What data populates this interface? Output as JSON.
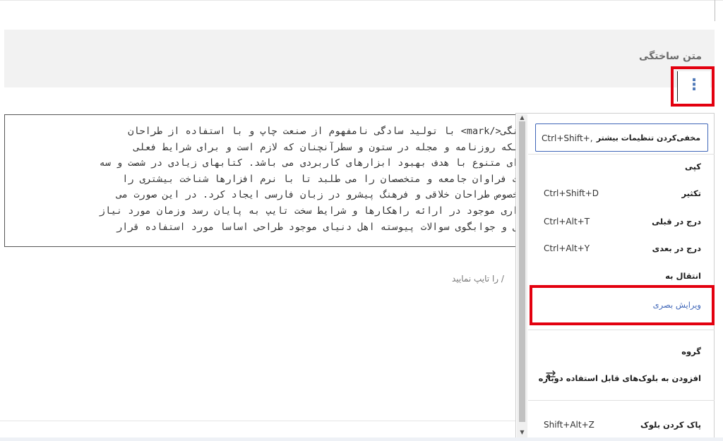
{
  "block": {
    "title": "متن ساختگی",
    "options_icon": "⋮"
  },
  "editor": {
    "lines": [
      "نگی</mark> با تولید سادگی نامفهوم از صنعت چاپ و با استفاده از طراحان",
      "لکه روزنامه و مجله در ستون و سطرآنچنان که لازم است و برای شرایط فعلی",
      "ای متنوع با هدف بهبود ابزارهای کاربردی می باشد. کتابهای زیادی در شصت و سه",
      "ت فراوان جامعه و متخصصان را می طلبد تا با نرم افزارها شناخت بیشتری را",
      "خصوص طراحان خلاقی و فرهنگ پیشرو در زبان فارسی ایجاد کرد. در این صورت می",
      "اری موجود در ارائه راهکارها و شرایط سخت تایپ به پایان رسد وزمان مورد نیاز",
      "ی و جوابگوی سوالات پیوسته اهل دنیای موجود طراحی اساسا مورد استفاده قرار"
    ],
    "hint": "/ را تایپ نمایید"
  },
  "menu": {
    "toggle_settings": {
      "label": "مخفی‌کردن تنظیمات بیشتر",
      "shortcut": "Ctrl+Shift+,"
    },
    "copy": {
      "label": "کپی"
    },
    "duplicate": {
      "label": "تکثیر",
      "shortcut": "Ctrl+Shift+D"
    },
    "insert_before": {
      "label": "درج در قبلی",
      "shortcut": "Ctrl+Alt+T"
    },
    "insert_after": {
      "label": "درج در بعدی",
      "shortcut": "Ctrl+Alt+Y"
    },
    "move_to": {
      "label": "انتقال به"
    },
    "edit_visually": {
      "label": "ویرایش بصری"
    },
    "group": {
      "label": "گروه"
    },
    "add_reusable": {
      "label": "افزودن به بلوک‌های قابل استفاده دوباره",
      "icon": "reusable-icon"
    },
    "remove_block": {
      "label": "پاک کردن بلوک",
      "shortcut": "Shift+Alt+Z"
    }
  },
  "colors": {
    "highlight": "#e3000f",
    "accent": "#3f66b8"
  }
}
